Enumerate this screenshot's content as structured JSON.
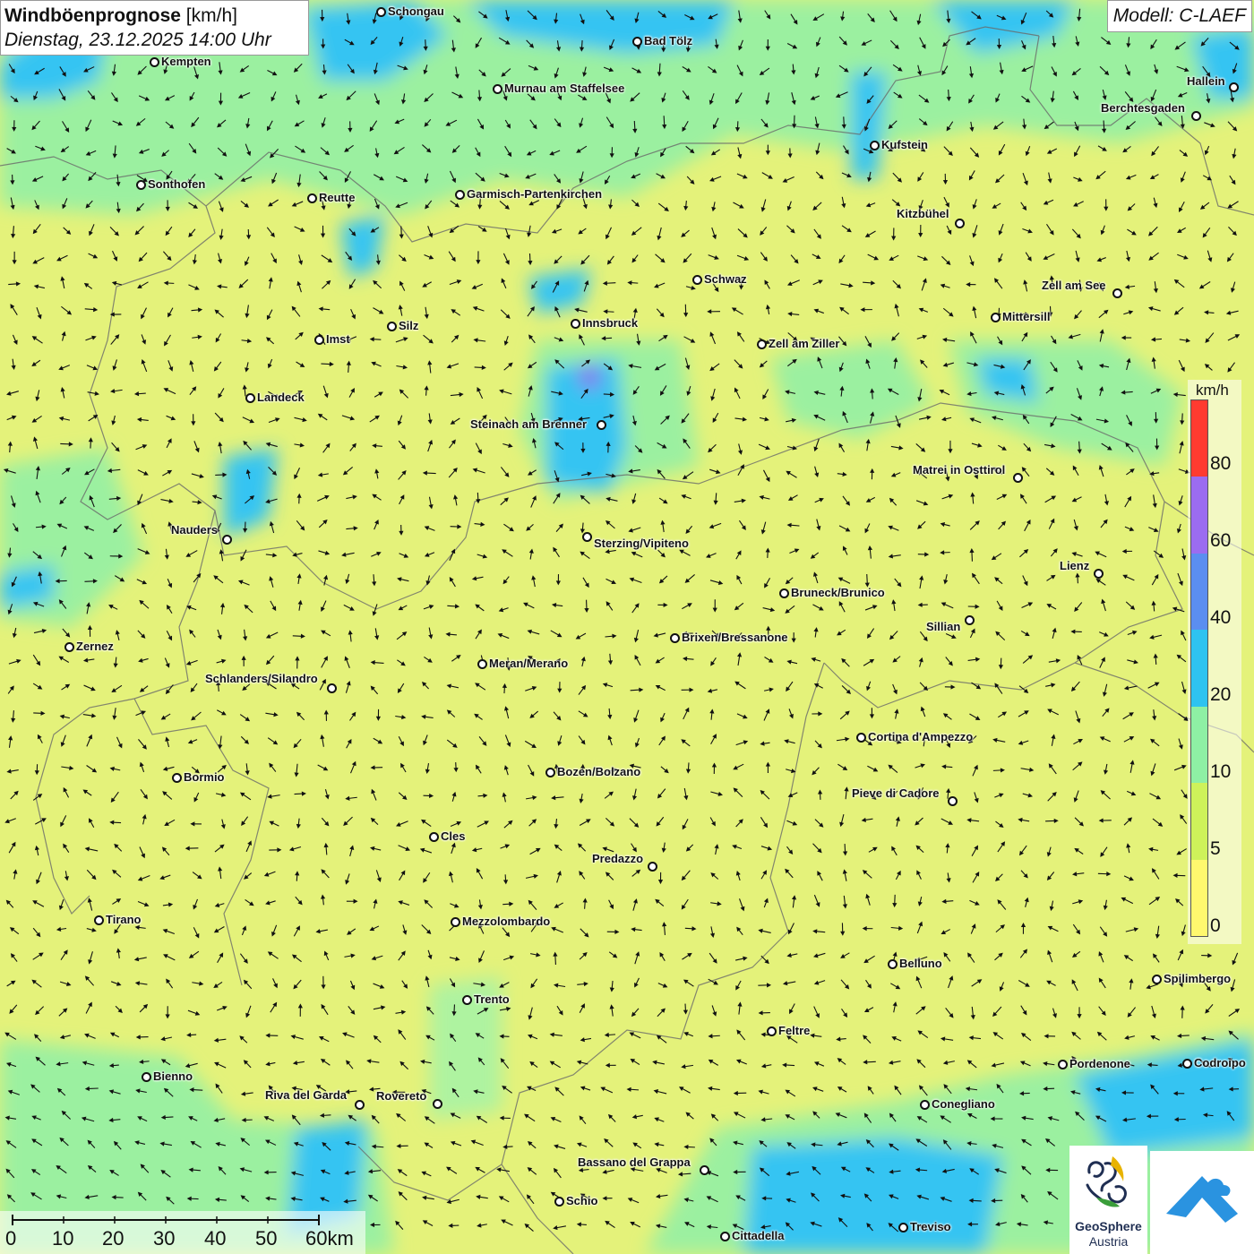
{
  "header": {
    "title": "Windböenprognose",
    "unit": " [km/h]",
    "datetime": "Dienstag, 23.12.2025 14:00 Uhr",
    "model": "Modell: C-LAEF"
  },
  "legend": {
    "unit": "km/h",
    "ticks": [
      "80",
      "60",
      "40",
      "20",
      "10",
      "5",
      "0"
    ],
    "colors": [
      "#ff3b30",
      "#9b6cf0",
      "#5b8ef0",
      "#2ec3f0",
      "#8ef0a4",
      "#cef25a",
      "#fff86e"
    ]
  },
  "scale": {
    "labels": [
      "0",
      "10",
      "20",
      "30",
      "40",
      "50",
      "60km"
    ]
  },
  "logos": {
    "geosphere": "GeoSphere",
    "geosphere_sub": "Austria"
  },
  "wind_arrows": {
    "prevailing_direction": "mixed/light",
    "icon": "wind-arrow-icon"
  },
  "cities": [
    {
      "name": "Schongau"
    },
    {
      "name": "Kempten"
    },
    {
      "name": "Bad Tölz"
    },
    {
      "name": "Murnau am Staffelsee"
    },
    {
      "name": "Hallein"
    },
    {
      "name": "Berchtesgaden"
    },
    {
      "name": "Kufstein"
    },
    {
      "name": "Sonthofen"
    },
    {
      "name": "Reutte"
    },
    {
      "name": "Garmisch-Partenkirchen"
    },
    {
      "name": "Kitzbühel"
    },
    {
      "name": "Schwaz"
    },
    {
      "name": "Zell am See"
    },
    {
      "name": "Mittersill"
    },
    {
      "name": "Innsbruck"
    },
    {
      "name": "Imst"
    },
    {
      "name": "Silz"
    },
    {
      "name": "Zell am Ziller"
    },
    {
      "name": "Landeck"
    },
    {
      "name": "Steinach am Brenner"
    },
    {
      "name": "Matrei in Osttirol"
    },
    {
      "name": "Nauders"
    },
    {
      "name": "Sterzing/Vipiteno"
    },
    {
      "name": "Lienz"
    },
    {
      "name": "Bruneck/Brunico"
    },
    {
      "name": "Sillian"
    },
    {
      "name": "Brixen/Bressanone"
    },
    {
      "name": "Zernez"
    },
    {
      "name": "Meran/Merano"
    },
    {
      "name": "Schlanders/Silandro"
    },
    {
      "name": "Cortina d'Ampezzo"
    },
    {
      "name": "Bozen/Bolzano"
    },
    {
      "name": "Bormio"
    },
    {
      "name": "Pieve di Cadore"
    },
    {
      "name": "Cles"
    },
    {
      "name": "Predazzo"
    },
    {
      "name": "Tirano"
    },
    {
      "name": "Mezzolombardo"
    },
    {
      "name": "Belluno"
    },
    {
      "name": "Spilimbergo"
    },
    {
      "name": "Trento"
    },
    {
      "name": "Feltre"
    },
    {
      "name": "Pordenone"
    },
    {
      "name": "Codroipo"
    },
    {
      "name": "Bienno"
    },
    {
      "name": "Riva del Garda"
    },
    {
      "name": "Rovereto"
    },
    {
      "name": "Conegliano"
    },
    {
      "name": "Bassano del Grappa"
    },
    {
      "name": "Schio"
    },
    {
      "name": "Treviso"
    },
    {
      "name": "Cittadella"
    }
  ]
}
